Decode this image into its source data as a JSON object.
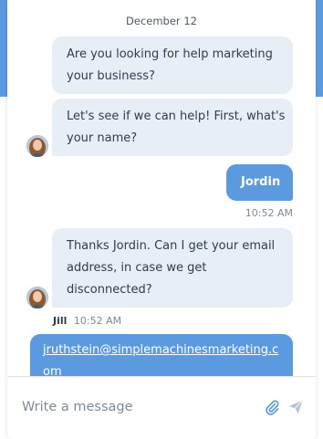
{
  "conversation": {
    "date": "December 12",
    "messages": [
      {
        "from": "agent",
        "text_lines": [
          "Are you looking for help marketing",
          "your business?"
        ]
      },
      {
        "from": "agent",
        "text_lines": [
          "Let's see if we can help! First, what's",
          "your name?"
        ]
      },
      {
        "from": "user",
        "text": "Jordin",
        "time": "10:52 AM"
      },
      {
        "from": "agent",
        "text_lines": [
          "Thanks Jordin. Can I get your email",
          "address, in case we get",
          "disconnected?"
        ],
        "author": "Jill",
        "time": "10:52 AM"
      },
      {
        "from": "user",
        "link": "jruthstein@simplemachinesmarketing.com"
      }
    ]
  },
  "composer": {
    "placeholder": "Write a message",
    "attach_icon": "paperclip-icon",
    "send_icon": "paper-plane-icon"
  },
  "colors": {
    "accent": "#5c9ae0",
    "agent_bubble": "#e8eef5",
    "text": "#2f3d4d",
    "muted": "#7c8a98"
  }
}
